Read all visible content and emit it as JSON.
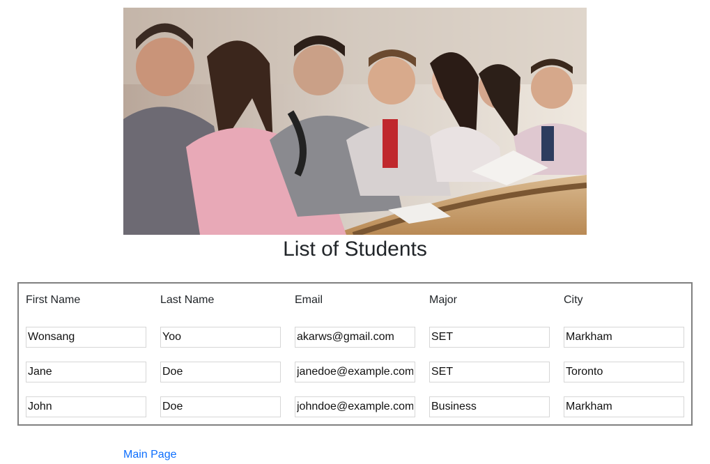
{
  "hero_image": {
    "alt": "Students writing in a lecture hall"
  },
  "title": "List of Students",
  "table": {
    "headers": [
      "First Name",
      "Last Name",
      "Email",
      "Major",
      "City"
    ],
    "rows": [
      [
        "Wonsang",
        "Yoo",
        "akarws@gmail.com",
        "SET",
        "Markham"
      ],
      [
        "Jane",
        "Doe",
        "janedoe@example.com",
        "SET",
        "Toronto"
      ],
      [
        "John",
        "Doe",
        "johndoe@example.com",
        "Business",
        "Markham"
      ]
    ]
  },
  "main_link": "Main Page",
  "colors": {
    "link": "#0d6efd",
    "table_border": "#808080",
    "text": "#212529"
  }
}
